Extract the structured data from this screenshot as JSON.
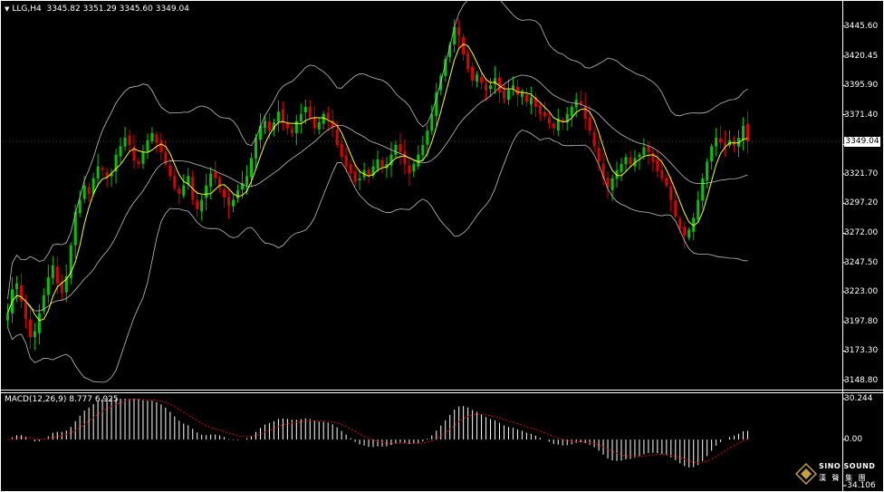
{
  "header": {
    "symbol": "LLG,H4",
    "ohlc": "3345.82 3351.29 3345.60 3349.04"
  },
  "macd_header": {
    "label": "MACD(12,26,9)",
    "values": "8.777 6.925"
  },
  "current_price": "3349.04",
  "logo": {
    "name": "SINO SOUND",
    "sub": "漢 聲 集 團"
  },
  "colors": {
    "background": "#000000",
    "bull": "#00c800",
    "bear": "#e00000",
    "bands": "#c0c0c0",
    "ma": "#ffff00",
    "macd_hist": "#ffffff",
    "macd_signal": "#e00000"
  },
  "chart_data": [
    {
      "type": "candlestick",
      "title": "LLG,H4",
      "y_ticks": [
        "3445.60",
        "3420.45",
        "3395.90",
        "3371.40",
        "3346.35",
        "3321.70",
        "3297.20",
        "3272.00",
        "3247.50",
        "3223.00",
        "3197.80",
        "3173.30",
        "3148.80"
      ],
      "ylim": [
        3141,
        3466
      ],
      "series": [
        {
          "name": "candles",
          "closes": [
            3205,
            3225,
            3230,
            3215,
            3200,
            3185,
            3190,
            3205,
            3220,
            3235,
            3245,
            3230,
            3222,
            3236,
            3262,
            3290,
            3300,
            3312,
            3305,
            3318,
            3328,
            3325,
            3318,
            3322,
            3338,
            3345,
            3352,
            3346,
            3333,
            3330,
            3340,
            3350,
            3356,
            3348,
            3340,
            3330,
            3320,
            3310,
            3305,
            3312,
            3320,
            3300,
            3292,
            3300,
            3312,
            3322,
            3318,
            3310,
            3302,
            3295,
            3300,
            3308,
            3314,
            3320,
            3335,
            3352,
            3362,
            3366,
            3358,
            3365,
            3374,
            3365,
            3360,
            3356,
            3366,
            3372,
            3378,
            3369,
            3360,
            3365,
            3372,
            3368,
            3360,
            3346,
            3336,
            3328,
            3322,
            3315,
            3318,
            3325,
            3320,
            3328,
            3334,
            3327,
            3330,
            3338,
            3346,
            3340,
            3330,
            3322,
            3330,
            3338,
            3346,
            3358,
            3372,
            3390,
            3404,
            3418,
            3430,
            3445,
            3438,
            3422,
            3410,
            3400,
            3405,
            3398,
            3392,
            3396,
            3402,
            3390,
            3385,
            3392,
            3396,
            3388,
            3390,
            3382,
            3386,
            3378,
            3372,
            3370,
            3364,
            3360,
            3368,
            3365,
            3372,
            3378,
            3384,
            3380,
            3368,
            3358,
            3345,
            3332,
            3318,
            3310,
            3318,
            3325,
            3330,
            3336,
            3330,
            3335,
            3338,
            3344,
            3340,
            3332,
            3324,
            3318,
            3312,
            3300,
            3286,
            3276,
            3270,
            3275,
            3285,
            3300,
            3318,
            3332,
            3345,
            3352,
            3348,
            3344,
            3350,
            3345,
            3352,
            3362,
            3349
          ]
        },
        {
          "name": "bollinger"
        },
        {
          "name": "ma"
        }
      ]
    },
    {
      "type": "bar",
      "title": "MACD(12,26,9)",
      "y_ticks": [
        "30.244",
        "0.00",
        "-34.106"
      ],
      "ylim": [
        -34.106,
        30.244
      ],
      "series": [
        {
          "name": "histogram"
        },
        {
          "name": "signal"
        }
      ]
    }
  ]
}
